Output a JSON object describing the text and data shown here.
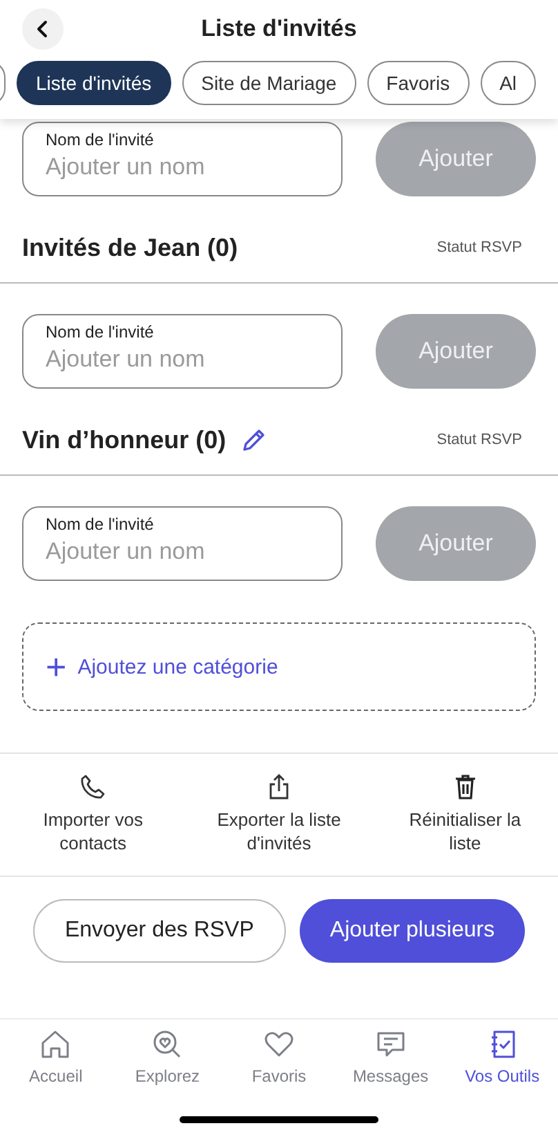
{
  "header": {
    "title": "Liste d'invités"
  },
  "tabs": [
    {
      "selected": false
    },
    {
      "label": "Liste d'invités",
      "selected": true
    },
    {
      "label": "Site de Mariage",
      "selected": false
    },
    {
      "label": "Favoris",
      "selected": false
    },
    {
      "label": "Al",
      "selected": false
    }
  ],
  "top_row": {
    "field_label": "Nom de l'invité",
    "placeholder": "Ajouter un nom",
    "button": "Ajouter",
    "disabled": true
  },
  "categories": [
    {
      "title": "Invités de Jean (0)",
      "editable": false,
      "status_label": "Statut RSVP",
      "field_label": "Nom de l'invité",
      "placeholder": "Ajouter un nom",
      "button": "Ajouter",
      "disabled": true
    },
    {
      "title": "Vin d’honneur (0)",
      "editable": true,
      "status_label": "Statut RSVP",
      "field_label": "Nom de l'invité",
      "placeholder": "Ajouter un nom",
      "button": "Ajouter",
      "disabled": true
    }
  ],
  "add_category": {
    "icon": "+",
    "label": "Ajoutez une catégorie"
  },
  "actions": [
    {
      "kind": "phone",
      "label": "Importer vos contacts"
    },
    {
      "kind": "export",
      "label": "Exporter la liste d'invités"
    },
    {
      "kind": "trash",
      "label": "Réinitialiser la liste"
    }
  ],
  "footer_buttons": [
    {
      "kind": "outline",
      "label": "Envoyer des RSVP"
    },
    {
      "kind": "primary",
      "label": "Ajouter plusieurs"
    }
  ],
  "nav": [
    {
      "kind": "home",
      "label": "Accueil",
      "selected": false
    },
    {
      "kind": "explore",
      "label": "Explorez",
      "selected": false
    },
    {
      "kind": "heart",
      "label": "Favoris",
      "selected": false
    },
    {
      "kind": "messages",
      "label": "Messages",
      "selected": false
    },
    {
      "kind": "tools",
      "label": "Vos Outils",
      "selected": true
    }
  ]
}
